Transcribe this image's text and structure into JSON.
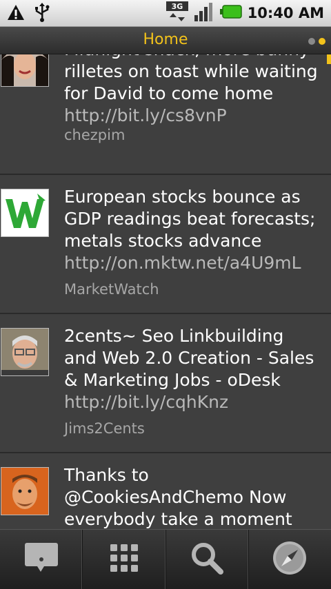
{
  "status_bar": {
    "time": "10:40 AM",
    "network": "3G",
    "icons": [
      "warning-icon",
      "usb-icon",
      "3g-icon",
      "signal-icon",
      "battery-icon"
    ]
  },
  "header": {
    "title": "Home",
    "page_dots": [
      "inactive",
      "active"
    ]
  },
  "colors": {
    "accent": "#f2c21b",
    "link": "#b9b9b9",
    "username": "#a7a7a7",
    "background": "#3f3f3f"
  },
  "tweets": [
    {
      "text": "Midnight snack, more bunny rilletes on toast while waiting for David to come home ",
      "link": "http://bit.ly/cs8vnP",
      "user": "chezpim"
    },
    {
      "text": "European stocks bounce as GDP readings beat forecasts; metals stocks advance ",
      "link": "http://on.mktw.net/a4U9mL",
      "user": "MarketWatch"
    },
    {
      "text": "2cents~ Seo Linkbuilding and Web 2.0 Creation - Sales & Marketing Jobs - oDesk ",
      "link": "http://bit.ly/cqhKnz",
      "user": "Jims2Cents"
    },
    {
      "text": "Thanks to @CookiesAndChemo Now everybody take a moment and",
      "link": "",
      "user": ""
    }
  ],
  "bottom_nav": [
    "compose-icon",
    "apps-grid-icon",
    "search-icon",
    "compass-icon"
  ]
}
